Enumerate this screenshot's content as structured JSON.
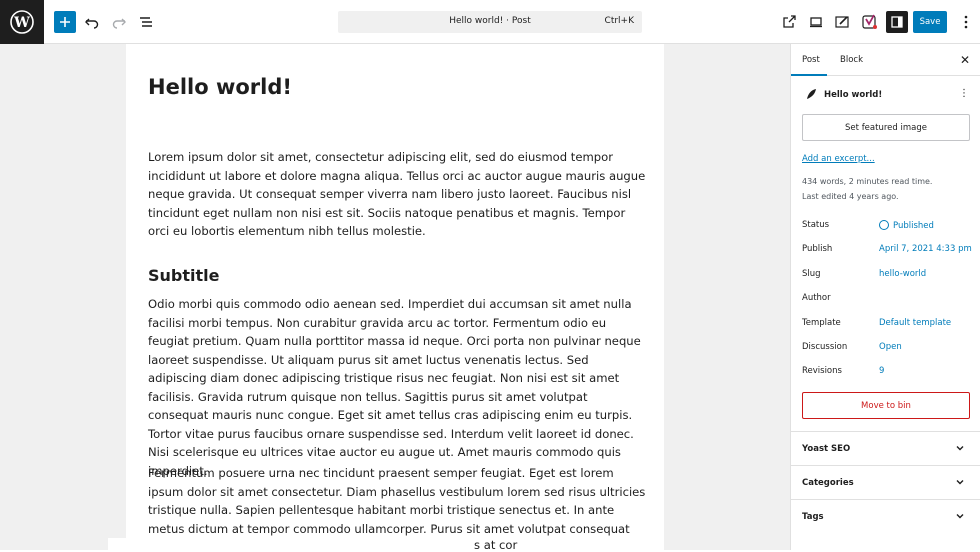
{
  "toolbar": {
    "document_title": "Hello world! · Post",
    "shortcut": "Ctrl+K",
    "save_label": "Save",
    "colors": {
      "accent": "#007cba",
      "dark": "#1e1e1e"
    }
  },
  "editor": {
    "title": "Hello world!",
    "paragraph1": "Lorem ipsum dolor sit amet, consectetur adipiscing elit, sed do eiusmod tempor incididunt ut labore et dolore magna aliqua. Tellus orci ac auctor augue mauris augue neque gravida. Ut consequat semper viverra nam libero justo laoreet. Faucibus nisl tincidunt eget nullam non nisi est sit. Sociis natoque penatibus et magnis. Tempor orci eu lobortis elementum nibh tellus molestie.",
    "subtitle": "Subtitle",
    "paragraph2": "Odio morbi quis commodo odio aenean sed. Imperdiet dui accumsan sit amet nulla facilisi morbi tempus. Non curabitur gravida arcu ac tortor. Fermentum odio eu feugiat pretium. Quam nulla porttitor massa id neque. Orci porta non pulvinar neque laoreet suspendisse. Ut aliquam purus sit amet luctus venenatis lectus. Sed adipiscing diam donec adipiscing tristique risus nec feugiat. Non nisi est sit amet facilisis. Gravida rutrum quisque non tellus. Sagittis purus sit amet volutpat consequat mauris nunc congue. Eget sit amet tellus cras adipiscing enim eu turpis. Tortor vitae purus faucibus ornare suspendisse sed. Interdum velit laoreet id donec. Nisi scelerisque eu ultrices vitae auctor eu augue ut. Amet mauris commodo quis imperdiet.",
    "paragraph3": "Fermentum posuere urna nec tincidunt praesent semper feugiat. Eget est lorem ipsum dolor sit amet consectetur. Diam phasellus vestibulum lorem sed risus ultricies tristique nulla. Sapien pellentesque habitant morbi tristique senectus et. In ante metus dictum at tempor commodo ullamcorper. Purus sit amet volutpat consequat mauris nunc congue nisi vitae. Sit amet luctus",
    "overflow_fragment": "s at cor"
  },
  "sidebar": {
    "tab_post": "Post",
    "tab_block": "Block",
    "post_name": "Hello world!",
    "featured_image_label": "Set featured image",
    "excerpt_link": "Add an excerpt...",
    "meta_words": "434 words, 2 minutes read time.",
    "meta_edited": "Last edited 4 years ago.",
    "rows": [
      {
        "label": "Status",
        "value": "Published"
      },
      {
        "label": "Publish",
        "value": "April 7, 2021 4:33 pm"
      },
      {
        "label": "Slug",
        "value": "hello-world"
      },
      {
        "label": "Author",
        "value": ""
      },
      {
        "label": "Template",
        "value": "Default template"
      },
      {
        "label": "Discussion",
        "value": "Open"
      },
      {
        "label": "Revisions",
        "value": "9"
      }
    ],
    "bin_label": "Move to bin",
    "panels": [
      "Yoast SEO",
      "Categories",
      "Tags"
    ]
  }
}
